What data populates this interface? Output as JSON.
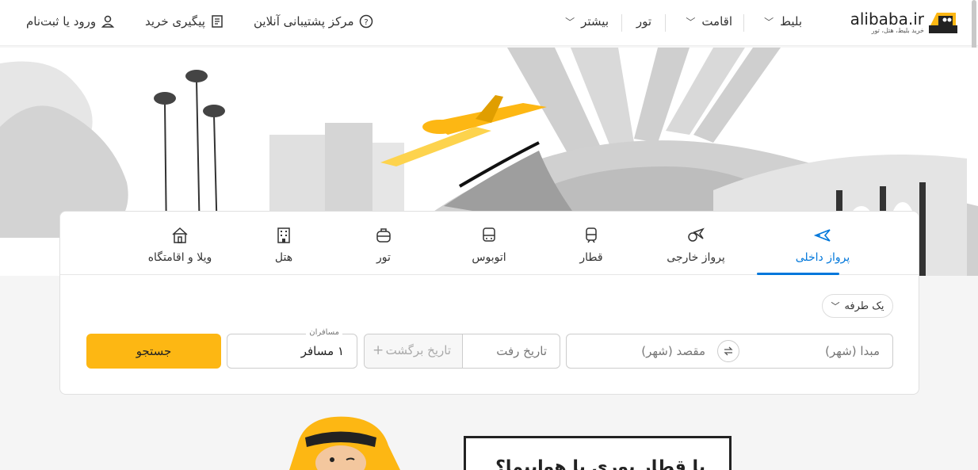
{
  "header": {
    "logo_text": "alibaba.ir",
    "logo_sub": "خرید بلیط، هتل، تور",
    "nav": [
      {
        "label": "بلیط",
        "has_menu": true
      },
      {
        "label": "اقامت",
        "has_menu": true
      },
      {
        "label": "تور",
        "has_menu": false
      },
      {
        "label": "بیشتر",
        "has_menu": true
      }
    ],
    "support_label": "مرکز پشتیبانی آنلاین",
    "track_label": "پیگیری خرید",
    "login_label": "ورود یا ثبت‌نام"
  },
  "tabs": [
    {
      "label": "پرواز داخلی",
      "icon": "plane-icon",
      "active": true
    },
    {
      "label": "پرواز خارجی",
      "icon": "globe-plane-icon",
      "active": false
    },
    {
      "label": "قطار",
      "icon": "train-icon",
      "active": false
    },
    {
      "label": "اتوبوس",
      "icon": "bus-icon",
      "active": false
    },
    {
      "label": "تور",
      "icon": "luggage-icon",
      "active": false
    },
    {
      "label": "هتل",
      "icon": "building-icon",
      "active": false
    },
    {
      "label": "ویلا و اقامتگاه",
      "icon": "house-icon",
      "active": false
    }
  ],
  "search": {
    "trip_type": "یک طرفه",
    "origin_placeholder": "مبدا (شهر)",
    "destination_placeholder": "مقصد (شهر)",
    "depart_placeholder": "تاریخ رفت",
    "return_placeholder": "تاریخ برگشت",
    "return_prefix": "+",
    "passengers_label": "مسافران",
    "passengers_value": "۱ مسافر",
    "search_button": "جستجو"
  },
  "promo": {
    "text": "با قطار یوری با هواپیما؟"
  },
  "colors": {
    "accent": "#0077db",
    "brand_yellow": "#fdb713"
  }
}
